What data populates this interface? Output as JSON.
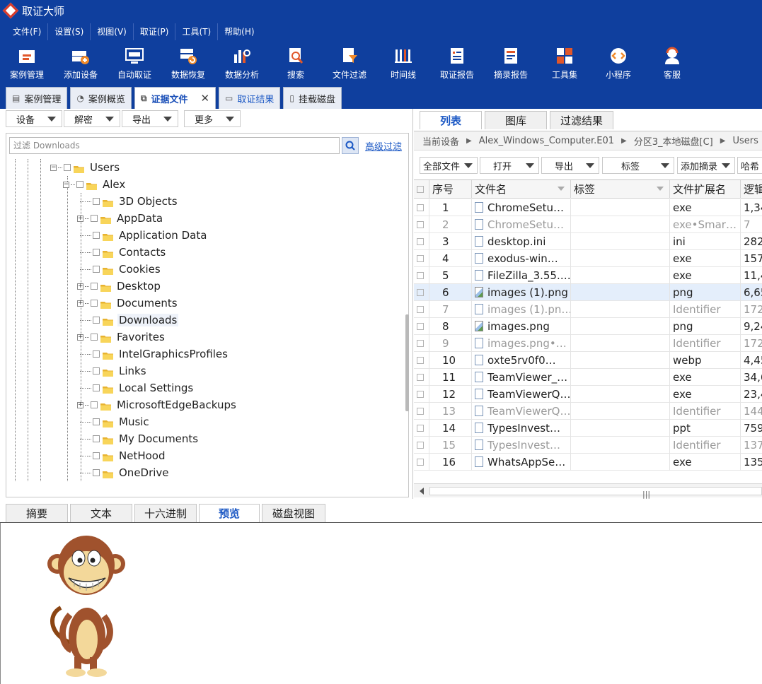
{
  "app": {
    "title": "取证大师"
  },
  "menu": [
    "文件(F)",
    "设置(S)",
    "视图(V)",
    "取证(P)",
    "工具(T)",
    "帮助(H)"
  ],
  "toolbar": [
    {
      "label": "案例管理",
      "icon": "case-folder-icon"
    },
    {
      "label": "添加设备",
      "icon": "add-device-icon"
    },
    {
      "label": "自动取证",
      "icon": "auto-forensics-icon"
    },
    {
      "label": "数据恢复",
      "icon": "data-recovery-icon"
    },
    {
      "label": "数据分析",
      "icon": "data-analysis-icon"
    },
    {
      "label": "搜索",
      "icon": "search-doc-icon"
    },
    {
      "label": "文件过滤",
      "icon": "file-filter-icon"
    },
    {
      "label": "时间线",
      "icon": "timeline-icon"
    },
    {
      "label": "取证报告",
      "icon": "forensic-report-icon"
    },
    {
      "label": "摘录报告",
      "icon": "excerpt-report-icon"
    },
    {
      "label": "工具集",
      "icon": "toolset-icon"
    },
    {
      "label": "小程序",
      "icon": "mini-program-icon"
    },
    {
      "label": "客服",
      "icon": "support-icon"
    }
  ],
  "main_tabs": [
    {
      "label": "案例管理",
      "icon": "case-icon"
    },
    {
      "label": "案例概览",
      "icon": "overview-icon"
    },
    {
      "label": "证据文件",
      "icon": "evidence-icon",
      "close": "✕"
    },
    {
      "label": "取证结果",
      "icon": "result-icon"
    },
    {
      "label": "挂载磁盘",
      "icon": "disk-icon"
    }
  ],
  "left": {
    "subtoolbar": [
      "设备",
      "解密",
      "导出",
      "更多"
    ],
    "filter_placeholder": "过滤 Downloads",
    "advanced_filter": "高级过滤",
    "tree": [
      {
        "label": "Users",
        "expander": "⊟"
      },
      {
        "label": "Alex",
        "expander": "⊟"
      },
      {
        "label": "3D Objects",
        "expander": ""
      },
      {
        "label": "AppData",
        "expander": "⊞"
      },
      {
        "label": "Application Data",
        "expander": ""
      },
      {
        "label": "Contacts",
        "expander": ""
      },
      {
        "label": "Cookies",
        "expander": ""
      },
      {
        "label": "Desktop",
        "expander": "⊞"
      },
      {
        "label": "Documents",
        "expander": "⊞"
      },
      {
        "label": "Downloads",
        "expander": ""
      },
      {
        "label": "Favorites",
        "expander": "⊞"
      },
      {
        "label": "IntelGraphicsProfiles",
        "expander": ""
      },
      {
        "label": "Links",
        "expander": ""
      },
      {
        "label": "Local Settings",
        "expander": ""
      },
      {
        "label": "MicrosoftEdgeBackups",
        "expander": "⊞"
      },
      {
        "label": "Music",
        "expander": ""
      },
      {
        "label": "My Documents",
        "expander": ""
      },
      {
        "label": "NetHood",
        "expander": ""
      },
      {
        "label": "OneDrive",
        "expander": ""
      }
    ]
  },
  "right": {
    "tabs": [
      "列表",
      "图库",
      "过滤结果"
    ],
    "breadcrumb": [
      "当前设备",
      "Alex_Windows_Computer.E01",
      "分区3_本地磁盘[C]",
      "Users"
    ],
    "subtoolbar": [
      "全部文件",
      "打开",
      "导出",
      "标签",
      "添加摘录",
      "哈希"
    ],
    "columns": [
      "序号",
      "文件名",
      "标签",
      "文件扩展名",
      "逻辑"
    ],
    "rows": [
      {
        "n": "1",
        "name": "ChromeSetu…",
        "tag": "",
        "ext": "exe",
        "size": "1,34",
        "icon": "file",
        "dim": false
      },
      {
        "n": "2",
        "name": "ChromeSetu…",
        "tag": "",
        "ext": "exe•Smar…",
        "size": "7",
        "icon": "file",
        "dim": true
      },
      {
        "n": "3",
        "name": "desktop.ini",
        "tag": "",
        "ext": "ini",
        "size": "282",
        "icon": "file",
        "dim": false
      },
      {
        "n": "4",
        "name": "exodus-win…",
        "tag": "",
        "ext": "exe",
        "size": "157,",
        "icon": "file",
        "dim": false
      },
      {
        "n": "5",
        "name": "FileZilla_3.55.…",
        "tag": "",
        "ext": "exe",
        "size": "11,4",
        "icon": "file",
        "dim": false
      },
      {
        "n": "6",
        "name": "images (1).png",
        "tag": "",
        "ext": "png",
        "size": "6,65",
        "icon": "image",
        "dim": false,
        "selected": true
      },
      {
        "n": "7",
        "name": "images (1).pn…",
        "tag": "",
        "ext": "Identifier",
        "size": "172",
        "icon": "file",
        "dim": true
      },
      {
        "n": "8",
        "name": "images.png",
        "tag": "",
        "ext": "png",
        "size": "9,24",
        "icon": "image",
        "dim": false
      },
      {
        "n": "9",
        "name": "images.png•…",
        "tag": "",
        "ext": "Identifier",
        "size": "172",
        "icon": "file",
        "dim": true
      },
      {
        "n": "10",
        "name": "oxte5rv0f0…",
        "tag": "",
        "ext": "webp",
        "size": "4,45",
        "icon": "file",
        "dim": false
      },
      {
        "n": "11",
        "name": "TeamViewer_…",
        "tag": "",
        "ext": "exe",
        "size": "34,6",
        "icon": "file",
        "dim": false
      },
      {
        "n": "12",
        "name": "TeamViewerQ…",
        "tag": "",
        "ext": "exe",
        "size": "23,4",
        "icon": "file",
        "dim": false
      },
      {
        "n": "13",
        "name": "TeamViewerQ…",
        "tag": "",
        "ext": "Identifier",
        "size": "144",
        "icon": "file",
        "dim": true
      },
      {
        "n": "14",
        "name": "TypesInvest…",
        "tag": "",
        "ext": "ppt",
        "size": "759,",
        "icon": "file",
        "dim": false
      },
      {
        "n": "15",
        "name": "TypesInvest…",
        "tag": "",
        "ext": "Identifier",
        "size": "137",
        "icon": "file",
        "dim": true
      },
      {
        "n": "16",
        "name": "WhatsAppSe…",
        "tag": "",
        "ext": "exe",
        "size": "135,",
        "icon": "file",
        "dim": false
      }
    ],
    "scroll_grip": "|||"
  },
  "bottom_tabs": [
    "摘要",
    "文本",
    "十六进制",
    "预览",
    "磁盘视图"
  ],
  "colors": {
    "brand": "#0f3f9e",
    "accent": "#1a57c4",
    "selected_row": "#e4eefb"
  }
}
